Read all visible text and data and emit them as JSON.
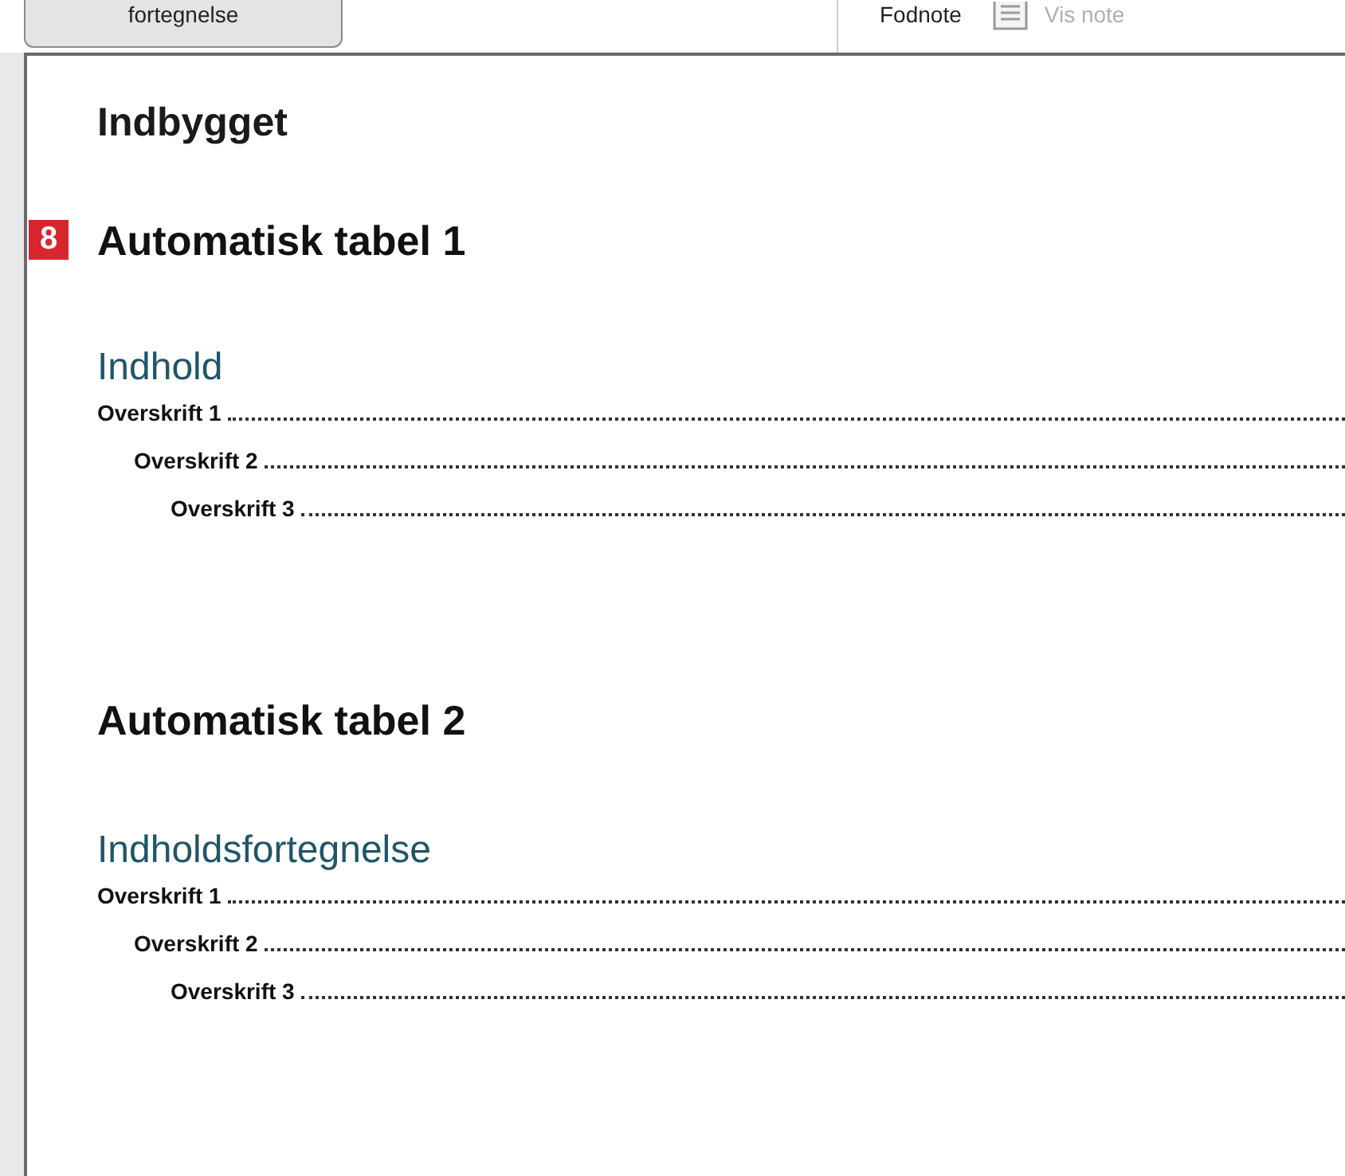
{
  "ribbon": {
    "toc_button": "fortegnelse",
    "footnote_label": "Fodnote",
    "show_notes": {
      "label": "Vis note",
      "disabled": true
    }
  },
  "gallery": {
    "header": "Indbygget",
    "badge": "8",
    "items": [
      {
        "title": "Automatisk tabel 1",
        "toc_heading": "Indhold",
        "entries": [
          {
            "text": "Overskrift 1",
            "children": [
              {
                "text": "Overskrift 2",
                "children": [
                  {
                    "text": "Overskrift 3"
                  }
                ]
              }
            ]
          }
        ]
      },
      {
        "title": "Automatisk tabel 2",
        "toc_heading": "Indholdsfortegnelse",
        "entries": [
          {
            "text": "Overskrift 1",
            "children": [
              {
                "text": "Overskrift 2",
                "children": [
                  {
                    "text": "Overskrift 3"
                  }
                ]
              }
            ]
          }
        ]
      }
    ]
  }
}
